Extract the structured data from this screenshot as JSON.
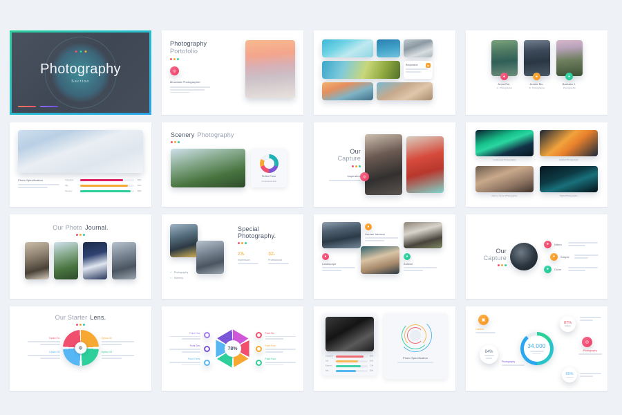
{
  "page": {
    "background": "#eef1f6",
    "selection_border_gradient": [
      "#2bd19a",
      "#29c4c9",
      "#2aa7ee"
    ],
    "grid": {
      "columns": 4,
      "rows": 4,
      "total_slides": 16
    }
  },
  "palette": {
    "pink": "#f0506e",
    "orange": "#f7a833",
    "green": "#2ecf9b",
    "blue": "#2f93e0",
    "purple": "#7b57d8",
    "teal": "#21b0b5",
    "text_dark": "#4a5568",
    "text_light": "#98a2b3"
  },
  "slides": [
    {
      "index": 1,
      "name": "hero-section",
      "selected": true,
      "title": "Photography",
      "subtitle": "Section",
      "accent_dots": [
        "#f0546d",
        "#2ecf9b",
        "#f7a833"
      ],
      "footer_bars": [
        "#f07a4a",
        "#8a6ef0"
      ]
    },
    {
      "index": 2,
      "name": "portfolio-intro",
      "selected": false,
      "title_bold": "Photography",
      "title_light": "Portofolio",
      "icon": "camera-icon",
      "icon_color": "#f0506e",
      "caption": "Mountain Photographer",
      "body": "Lorem ipsum dolor sit amet, consectetur elit, sed do eiusmod tempus.",
      "photo": "surfer-at-sunset"
    },
    {
      "index": 3,
      "name": "photo-mosaic",
      "selected": false,
      "card_title": "Responsive",
      "card_body": "Lorem ipsum dolor sit amet consectetur.",
      "icon": "layers-icon",
      "icon_color": "#f7a833",
      "photos": [
        "aerial-surfers",
        "diver",
        "rocky-shore",
        "coastal-beach",
        "pier-sunset",
        "friends-on-beach"
      ]
    },
    {
      "index": 4,
      "name": "team-profiles",
      "selected": false,
      "members": [
        {
          "name": "Anna Ful.",
          "role": "Jr. Photographer",
          "color": "#f0506e",
          "icon": "user-icon",
          "photo": "lake-and-hiker"
        },
        {
          "name": "Jennie Mo.",
          "role": "Sr. Photographer",
          "color": "#f7a833",
          "icon": "camera-icon",
          "photo": "mountain-peaks"
        },
        {
          "name": "Barbara J.",
          "role": "Photographer",
          "color": "#2ecf9b",
          "icon": "aperture-icon",
          "photo": "pink-sky-pines"
        }
      ]
    },
    {
      "index": 5,
      "name": "photo-specification-bars",
      "selected": false,
      "heading": "Photo Specification",
      "body": "Lorem ipsum dolor sit amet, consectetur adipiscing elit, sed do.",
      "photo": "snow-mountain-hikers",
      "bars": [
        {
          "label": "Character",
          "value": "80%",
          "color": "#e01f63"
        },
        {
          "label": "Sky",
          "value": "70%",
          "color": "#f7a833"
        },
        {
          "label": "Scenery",
          "value": "85%",
          "color": "#2ecf9b"
        }
      ]
    },
    {
      "index": 6,
      "name": "scenery-photography",
      "selected": false,
      "title_bold": "Scenery",
      "title_light": "Photography",
      "photo": "mountain-river-valley",
      "donut_label": "Perfect Photo",
      "donut_sub": "Consectetur Elit",
      "donut_colors": [
        "#21b0b5",
        "#7b57d8",
        "#f0506e",
        "#f7a833"
      ]
    },
    {
      "index": 7,
      "name": "our-capture-portraits",
      "selected": false,
      "title_line1": "Our",
      "title_line2": "Capture",
      "caption": "Inspiration",
      "body": "Lorem ipsum dolor sit",
      "icon": "aperture-icon",
      "icon_color": "#f0506e",
      "photos": [
        "girl-black-jacket",
        "girl-red-jacket"
      ]
    },
    {
      "index": 8,
      "name": "landscape-gallery-4",
      "selected": false,
      "items": [
        {
          "caption": "Landscape Photography",
          "photo": "aurora-borealis"
        },
        {
          "caption": "Habitat Photography",
          "photo": "bridge-at-night"
        },
        {
          "caption": "Nature Sense Photography",
          "photo": "crowd-party"
        },
        {
          "caption": "Night Photography",
          "photo": "bokeh-night"
        }
      ]
    },
    {
      "index": 9,
      "name": "photo-journal",
      "selected": false,
      "title_light": "Our Photo",
      "title_bold": "Journal.",
      "photos": [
        "portrait-cyclist",
        "river-bend",
        "glass-tower",
        "skate-jump"
      ]
    },
    {
      "index": 10,
      "name": "special-photography-stats",
      "selected": false,
      "title_line1": "Special",
      "title_line2": "Photography.",
      "checks": [
        "Photography",
        "Scenery"
      ],
      "stats": [
        {
          "value": "23",
          "suffix": "k",
          "label": "Impression",
          "body": "Lorem ipsum dolor",
          "color": "#f7a833"
        },
        {
          "value": "32",
          "suffix": "k",
          "label": "Professional",
          "body": "Lorem ipsum dolor",
          "color": "#f7a833"
        }
      ],
      "photos": [
        "street-cyclist",
        "city-street"
      ]
    },
    {
      "index": 11,
      "name": "category-grid",
      "selected": false,
      "categories": [
        {
          "title": "Human Interest",
          "body": "Lorem ipsum dolor sit amet, consectetur.",
          "color": "#f7a833",
          "icon": "user-icon"
        },
        {
          "title": "Landscape",
          "body": "Lorem ipsum dolor sit amet consectetur.",
          "color": "#f0506e",
          "icon": "mountain-icon"
        },
        {
          "title": "Animal",
          "body": "Lorem ipsum dolor sit amet, consectetur.",
          "color": "#2ecf9b",
          "icon": "paw-icon"
        }
      ],
      "photos": [
        "misty-mountains",
        "panda",
        "portrait-man"
      ]
    },
    {
      "index": 12,
      "name": "our-capture-bullets",
      "selected": false,
      "title_line1": "Our",
      "title_line2": "Capture",
      "photo": "camera-lens-round",
      "bullets": [
        {
          "label": "Nikon",
          "body": "Lorem ipsum dolor sit amet consectetur.",
          "color": "#f0506e",
          "icon": "camera-icon"
        },
        {
          "label": "Simple",
          "body": "Lorem ipsum dolor sit amet consectetur.",
          "color": "#f7a833",
          "icon": "star-icon"
        },
        {
          "label": "Cube",
          "body": "Lorem ipsum dolor sit amet consectetur.",
          "color": "#2ecf9b",
          "icon": "cube-icon"
        }
      ]
    },
    {
      "index": 13,
      "name": "starter-lens-cycle",
      "selected": false,
      "title_light": "Our Starter",
      "title_bold": "Lens.",
      "center_icon": "gear-icon",
      "options": [
        {
          "label": "Option 01",
          "body": "Lorem ipsum dolor sit amet consectetur.",
          "color": "#f0506e",
          "icon": "camera-icon"
        },
        {
          "label": "Option 02",
          "body": "Lorem ipsum dolor sit amet consectetur.",
          "color": "#f7a833",
          "icon": "image-icon"
        },
        {
          "label": "Option 03",
          "body": "Lorem ipsum dolor sit amet consectetur.",
          "color": "#57b7f5",
          "icon": "monitor-icon"
        },
        {
          "label": "Option 04",
          "body": "Lorem ipsum dolor sit amet consectetur.",
          "color": "#2ecf9b",
          "icon": "aperture-icon"
        }
      ]
    },
    {
      "index": 14,
      "name": "aperture-percent-diagram",
      "selected": false,
      "center_value": "78%",
      "points": [
        {
          "label": "Point One",
          "body": "Lorem ipsum dolor sit amet consectetur.",
          "color": "#a07bf0",
          "side": "left"
        },
        {
          "label": "Point Two",
          "body": "Lorem ipsum dolor sit amet consectetur.",
          "color": "#7b57d8",
          "side": "left"
        },
        {
          "label": "Point Three",
          "body": "Lorem ipsum dolor sit amet consectetur.",
          "color": "#57b7f5",
          "side": "left"
        },
        {
          "label": "Point Six",
          "body": "Lorem ipsum dolor sit amet consectetur.",
          "color": "#f0506e",
          "side": "right"
        },
        {
          "label": "Point Five",
          "body": "Lorem ipsum dolor sit amet consectetur.",
          "color": "#f7a833",
          "side": "right"
        },
        {
          "label": "Point Four",
          "body": "Lorem ipsum dolor sit amet consectetur.",
          "color": "#2ecf9b",
          "side": "right"
        }
      ]
    },
    {
      "index": 15,
      "name": "specification-rings",
      "selected": false,
      "photo": "camera-dark",
      "bars": [
        {
          "label": "Character",
          "value": "80%",
          "color": "#ef6b72"
        },
        {
          "label": "Sky",
          "value": "65%",
          "color": "#f7b955"
        },
        {
          "label": "Element",
          "value": "72%",
          "color": "#3bd0a8"
        },
        {
          "label": "Ads",
          "value": "58%",
          "color": "#56b6ef"
        }
      ],
      "ring_title": "Photo Specification",
      "ring_body": "Lorem ipsum adipiscing elit, sed do."
    },
    {
      "index": 16,
      "name": "kpi-dashboard",
      "selected": false,
      "center_value": "34.000",
      "center_sub": "Lorem ipsum dolor sit amet sit",
      "items": [
        {
          "value": "87%",
          "sub": "Gallery",
          "color": "#f0506e"
        },
        {
          "value": "84%",
          "sub": "Lorem ipsum consectetur",
          "color": "#f7a833"
        },
        {
          "value": "65%",
          "sub": "Lorem ipsum dolor",
          "color": "#57b7f5"
        }
      ],
      "labels": [
        {
          "text": "Camera",
          "body": "Lorem ipsum dolor sit",
          "color": "#f7a833",
          "icon": "camera-icon"
        },
        {
          "text": "Photography",
          "body": "Lorem ipsum dolor sit",
          "color": "#f0506e",
          "icon": "aperture-icon"
        },
        {
          "text": "Photography",
          "body": "Lorem ipsum dolor sit",
          "color": "#7b57d8",
          "icon": "image-icon"
        }
      ]
    }
  ]
}
